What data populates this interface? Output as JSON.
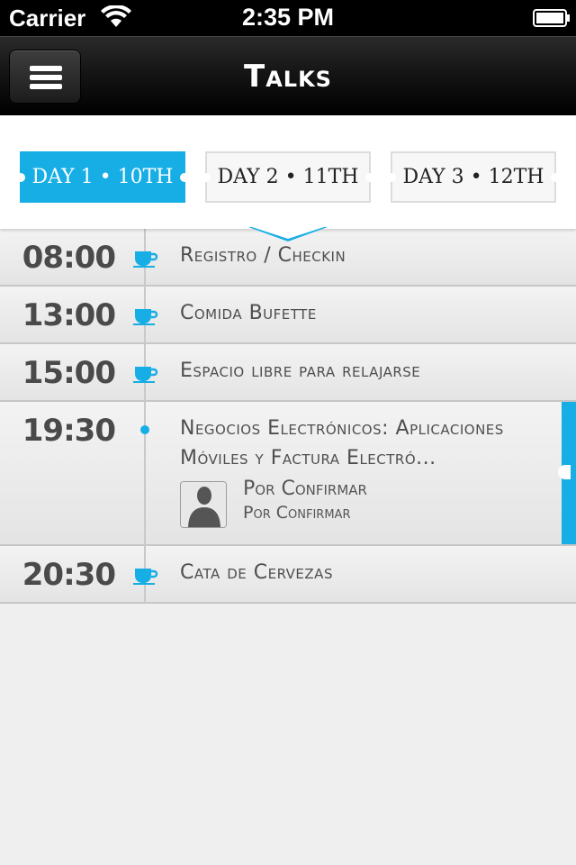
{
  "status_bar": {
    "carrier": "Carrier",
    "time": "2:35 PM"
  },
  "nav": {
    "title": "Talks",
    "menu_icon": "hamburger-menu-icon"
  },
  "tabs": [
    {
      "label": "DAY 1 • 10TH",
      "active": true
    },
    {
      "label": "DAY 2 • 11TH",
      "active": false
    },
    {
      "label": "DAY 3 • 12TH",
      "active": false
    }
  ],
  "schedule": [
    {
      "time": "08:00",
      "title": "Registro / Checkin",
      "icon": "coffee-cup-icon"
    },
    {
      "time": "13:00",
      "title": "Comida Bufette",
      "icon": "coffee-cup-icon"
    },
    {
      "time": "15:00",
      "title": "Espacio libre para relajarse",
      "icon": "coffee-cup-icon"
    },
    {
      "time": "19:30",
      "title_line1": "Negocios Electrónicos: Aplicaciones",
      "title_line2": "Móviles y Factura Electró...",
      "icon": "timeline-dot",
      "speaker_name": "Por Confirmar",
      "speaker_org": "Por Confirmar",
      "selected": true
    },
    {
      "time": "20:30",
      "title": "Cata de Cervezas",
      "icon": "coffee-cup-icon"
    }
  ],
  "colors": {
    "accent": "#16aee5",
    "nav_bg": "#000000",
    "row_text": "#4e4e4e"
  }
}
